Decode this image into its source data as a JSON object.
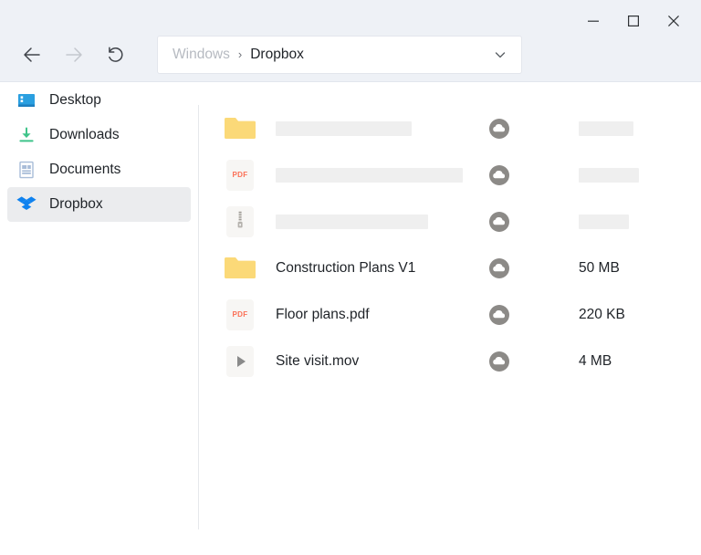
{
  "window": {
    "controls": [
      {
        "name": "minimize",
        "glyph": "minimize-icon"
      },
      {
        "name": "maximize",
        "glyph": "maximize-icon"
      },
      {
        "name": "close",
        "glyph": "close-icon"
      }
    ]
  },
  "toolbar": {
    "back_icon": "arrow-left-icon",
    "forward_icon": "arrow-right-icon",
    "refresh_icon": "refresh-icon",
    "back_enabled": true,
    "forward_enabled": false
  },
  "address": {
    "parent": "Windows",
    "separator": "›",
    "current": "Dropbox",
    "chevron_icon": "chevron-down-icon"
  },
  "sidebar": {
    "items": [
      {
        "label": "Desktop",
        "icon": "desktop-icon",
        "active": false
      },
      {
        "label": "Downloads",
        "icon": "download-icon",
        "active": false
      },
      {
        "label": "Documents",
        "icon": "documents-icon",
        "active": false
      },
      {
        "label": "Dropbox",
        "icon": "dropbox-icon",
        "active": true
      }
    ]
  },
  "files": {
    "rows": [
      {
        "icon": "folder-icon",
        "name": "",
        "name_loading": true,
        "name_skeleton_width": 149,
        "status_icon": "cloud-icon",
        "size": "",
        "size_loading": true,
        "size_skeleton_width": 60
      },
      {
        "icon": "pdf-file-icon",
        "name": "",
        "name_loading": true,
        "name_skeleton_width": 205,
        "status_icon": "cloud-icon",
        "size": "",
        "size_loading": true,
        "size_skeleton_width": 66
      },
      {
        "icon": "zip-file-icon",
        "name": "",
        "name_loading": true,
        "name_skeleton_width": 167,
        "status_icon": "cloud-icon",
        "size": "",
        "size_loading": true,
        "size_skeleton_width": 55
      },
      {
        "icon": "folder-icon",
        "name": "Construction Plans V1",
        "name_loading": false,
        "status_icon": "cloud-icon",
        "size": "50 MB",
        "size_loading": false
      },
      {
        "icon": "pdf-file-icon",
        "name": "Floor plans.pdf",
        "name_loading": false,
        "status_icon": "cloud-icon",
        "size": "220 KB",
        "size_loading": false
      },
      {
        "icon": "video-file-icon",
        "name": "Site visit.mov",
        "name_loading": false,
        "status_icon": "cloud-icon",
        "size": "4 MB",
        "size_loading": false
      }
    ]
  },
  "colors": {
    "header_bg": "#eef1f6",
    "folder": "#fbd978",
    "dropbox_blue": "#0f82ef",
    "download_green": "#3fc48a",
    "desktop_blue": "#2a9fe0",
    "documents_blue": "#a9bdd8",
    "pdf_red": "#fb7056",
    "cloud_gray": "#8c8a87",
    "skeleton": "#efefef",
    "text": "#1f2328"
  }
}
